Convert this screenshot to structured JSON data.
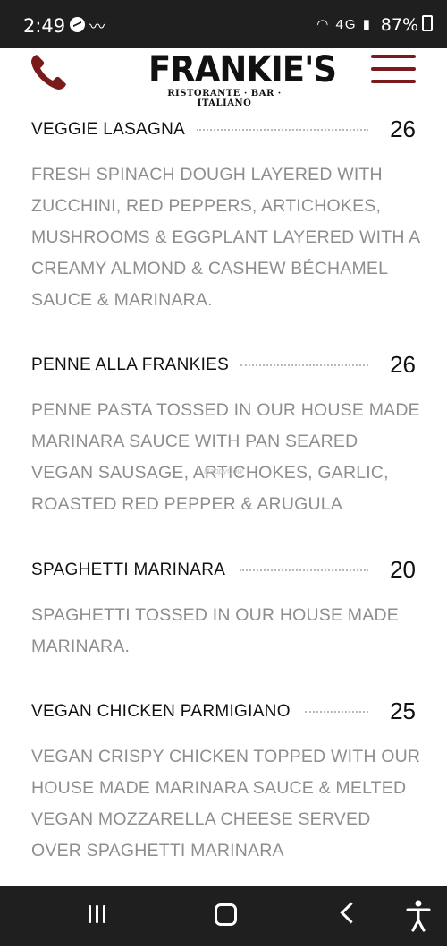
{
  "status_bar": {
    "time": "2:49",
    "battery": "87%",
    "network": "4G"
  },
  "header": {
    "logo_title": "FRANKIE'S",
    "logo_subtitle": "RISTORANTE · BAR · ITALIANO",
    "accent_color": "#7a1a1a"
  },
  "menu": {
    "items": [
      {
        "name": "VEGGIE LASAGNA",
        "price": "26",
        "description": "FRESH SPINACH DOUGH LAYERED WITH ZUCCHINI, RED PEPPERS, ARTICHOKES, MUSHROOMS & EGGPLANT LAYERED WITH A CREAMY ALMOND & CASHEW BÉCHAMEL SAUCE & MARINARA."
      },
      {
        "name": "PENNE ALLA FRANKIES",
        "price": "26",
        "description": "PENNE PASTA TOSSED IN OUR HOUSE MADE MARINARA SAUCE WITH PAN SEARED VEGAN SAUSAGE, ARTICHOKES, GARLIC, ROASTED RED PEPPER & ARUGULA"
      },
      {
        "name": "SPAGHETTI MARINARA",
        "price": "20",
        "description": "SPAGHETTI TOSSED IN OUR HOUSE MADE MARINARA."
      },
      {
        "name": "VEGAN CHICKEN PARMIGIANO",
        "price": "25",
        "description": "VEGAN CRISPY CHICKEN TOPPED WITH OUR HOUSE MADE MARINARA SAUCE & MELTED VEGAN MOZZARELLA CHEESE SERVED OVER SPAGHETTI MARINARA"
      }
    ]
  },
  "watermark": "HappyCow",
  "icons": {
    "phone": "phone-icon",
    "menu": "hamburger-menu-icon",
    "recents": "recent-apps-icon",
    "home": "home-icon",
    "back": "back-icon",
    "accessibility": "accessibility-icon"
  }
}
